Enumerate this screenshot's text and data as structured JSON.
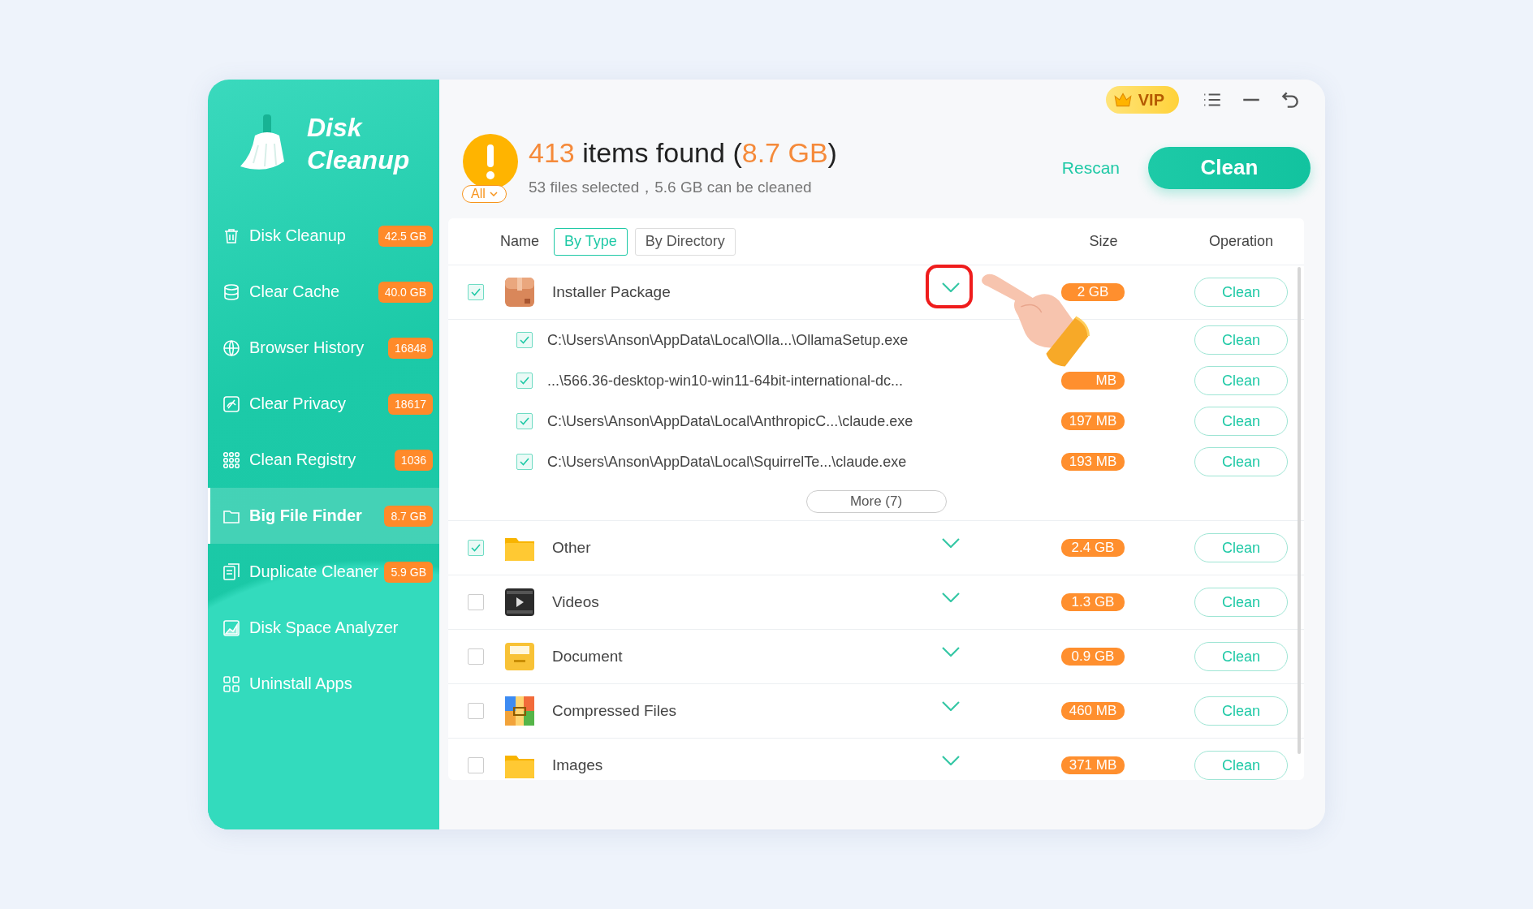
{
  "window": {
    "vip_label": "VIP"
  },
  "sidebar": {
    "logo": {
      "line_1": "Disk",
      "line_2": "Cleanup"
    },
    "items": [
      {
        "label": "Disk Cleanup",
        "badge": "42.5 GB",
        "selected": false
      },
      {
        "label": "Clear Cache",
        "badge": "40.0 GB",
        "selected": false
      },
      {
        "label": "Browser History",
        "badge": "16848",
        "selected": false
      },
      {
        "label": "Clear Privacy",
        "badge": "18617",
        "selected": false
      },
      {
        "label": "Clean Registry",
        "badge": "1036",
        "selected": false
      },
      {
        "label": "Big File Finder",
        "badge": "8.7 GB",
        "selected": true
      },
      {
        "label": "Duplicate Cleaner",
        "badge": "5.9 GB",
        "selected": false
      },
      {
        "label": "Disk Space Analyzer",
        "selected": false
      },
      {
        "label": "Uninstall Apps",
        "selected": false
      }
    ]
  },
  "summary": {
    "title": [
      {
        "text": "413",
        "accent": true
      },
      {
        "text": " items found (",
        "accent": false
      },
      {
        "text": "8.7 GB",
        "accent": true
      },
      {
        "text": ")",
        "accent": false
      }
    ],
    "subtitle": "53 files selected，5.6 GB can be cleaned",
    "filter": "All"
  },
  "actions": {
    "rescan": "Rescan",
    "clean": "Clean"
  },
  "table": {
    "columns": {
      "name": "Name",
      "size": "Size",
      "operation": "Operation"
    },
    "view_tabs": [
      {
        "label": "By Type",
        "selected": true
      },
      {
        "label": "By Directory",
        "selected": false
      }
    ],
    "groups": [
      {
        "kind": "package",
        "name": "Installer Package",
        "checked": true,
        "size": "2 GB",
        "action": "Clean",
        "files": [
          {
            "path": "C:\\Users\\Anson\\AppData\\Local\\Olla...\\OllamaSetup.exe",
            "checked": true,
            "action": "Clean"
          },
          {
            "path": "...\\566.36-desktop-win10-win11-64bit-international-dc...",
            "checked": true,
            "size": "MB",
            "action": "Clean"
          },
          {
            "path": "C:\\Users\\Anson\\AppData\\Local\\AnthropicC...\\claude.exe",
            "checked": true,
            "size": "197 MB",
            "action": "Clean"
          },
          {
            "path": "C:\\Users\\Anson\\AppData\\Local\\SquirrelTe...\\claude.exe",
            "checked": true,
            "size": "193 MB",
            "action": "Clean"
          }
        ],
        "more": "More (7)"
      },
      {
        "kind": "folder",
        "name": "Other",
        "checked": true,
        "size": "2.4 GB",
        "action": "Clean"
      },
      {
        "kind": "video",
        "name": "Videos",
        "checked": false,
        "size": "1.3 GB",
        "action": "Clean"
      },
      {
        "kind": "document",
        "name": "Document",
        "checked": false,
        "size": "0.9 GB",
        "action": "Clean"
      },
      {
        "kind": "archive",
        "name": "Compressed Files",
        "checked": false,
        "size": "460 MB",
        "action": "Clean"
      },
      {
        "kind": "folder",
        "name": "Images",
        "checked": false,
        "size": "371 MB",
        "action": "Clean"
      }
    ]
  }
}
